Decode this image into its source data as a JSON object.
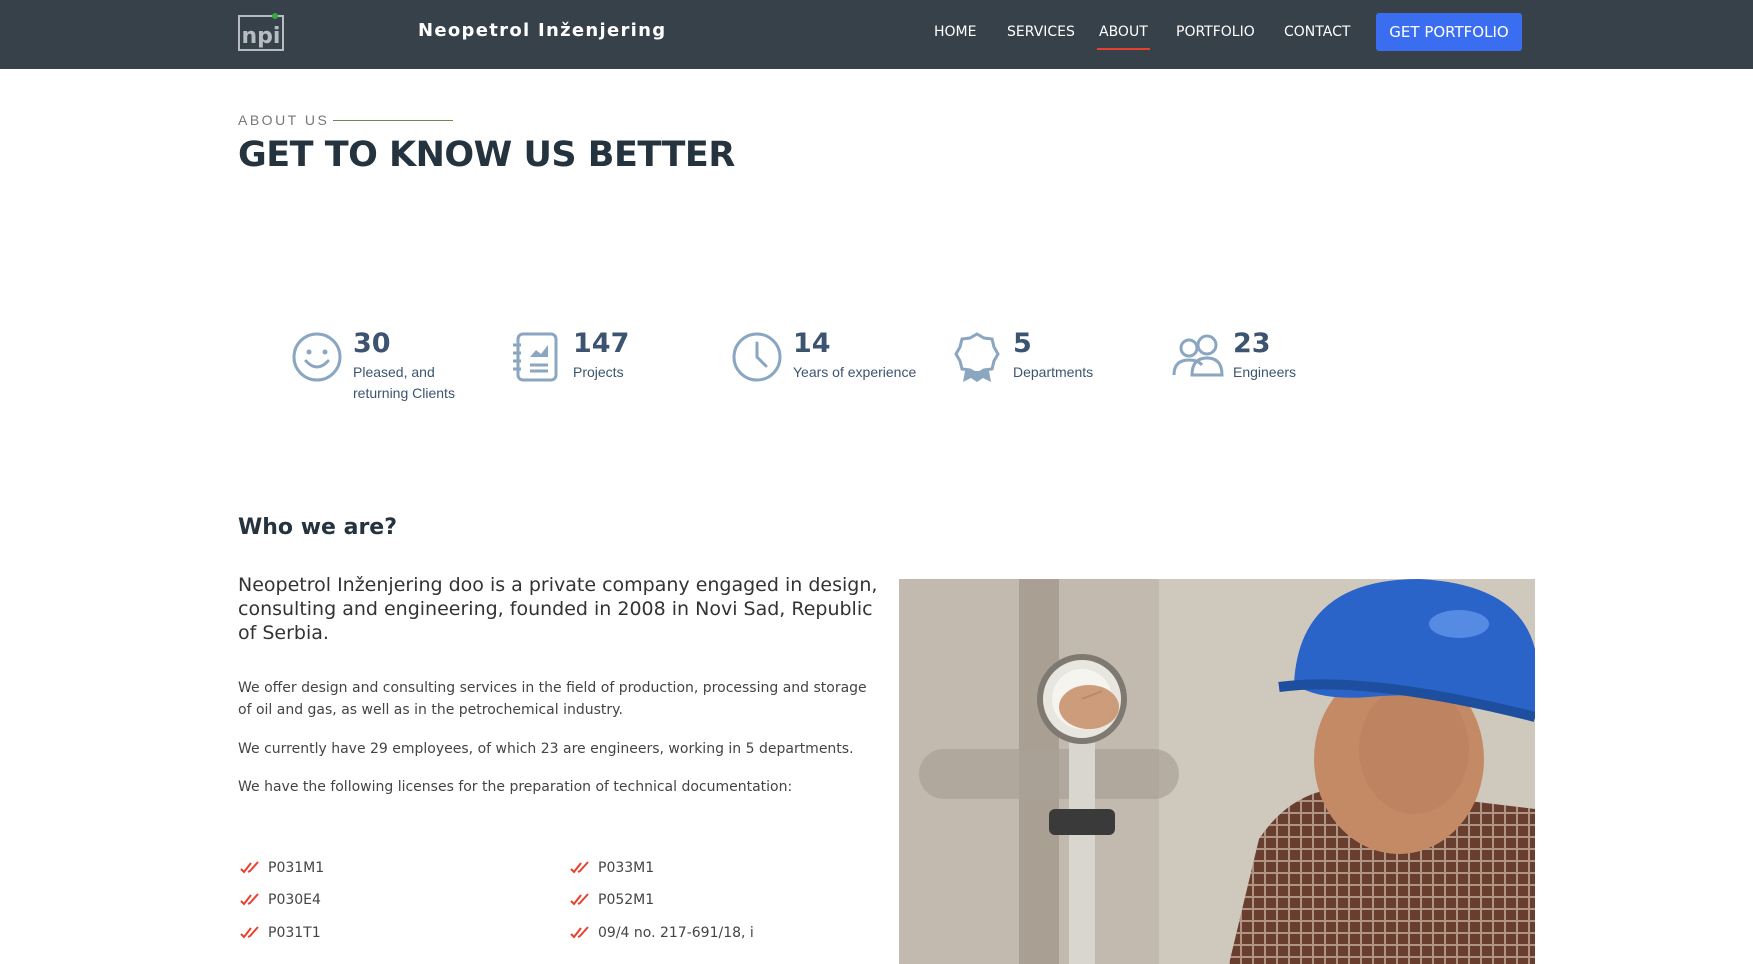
{
  "navbar": {
    "brand": "Neopetrol Inženjering",
    "logo_text": "npi",
    "links": [
      "HOME",
      "SERVICES",
      "ABOUT",
      "PORTFOLIO",
      "CONTACT"
    ],
    "active": "ABOUT",
    "cta": "GET PORTFOLIO",
    "colors": {
      "background": "#37414a",
      "accent": "#e8402f",
      "cta": "#3a6df0"
    }
  },
  "section": {
    "eyebrow": "ABOUT US",
    "title": "GET TO KNOW US BETTER"
  },
  "counters": [
    {
      "icon": "smile-icon",
      "value": "30",
      "label_lines": [
        "Pleased, and",
        "returning Clients"
      ]
    },
    {
      "icon": "report-icon",
      "value": "147",
      "label_lines": [
        "Projects"
      ]
    },
    {
      "icon": "clock-icon",
      "value": "14",
      "label_lines": [
        "Years of experience"
      ]
    },
    {
      "icon": "award-icon",
      "value": "5",
      "label_lines": [
        "Departments"
      ]
    },
    {
      "icon": "users-icon",
      "value": "23",
      "label_lines": [
        "Engineers"
      ]
    }
  ],
  "who": {
    "heading": "Who we are?",
    "lead_lines": [
      "Neopetrol Inženjering doo is a private company engaged in design,",
      "consulting and engineering, founded in 2008 in Novi Sad, Republic",
      "of Serbia."
    ],
    "para1_lines": [
      "We offer design and consulting services in the field of production, processing and storage",
      "of oil and gas, as well as in the petrochemical industry."
    ],
    "para2": "We currently have 29 employees, of which 23 are engineers, working in 5 departments.",
    "para3": "We have the following licenses for the preparation of technical documentation:",
    "licenses_left": [
      "P031M1",
      "P030E4",
      "P031T1"
    ],
    "licenses_right": [
      "P033M1",
      "P052M1",
      "09/4 no. 217-691/18, i"
    ]
  },
  "photo": {
    "icon": "engineer-photo",
    "colors": {
      "helmet": "#2a64c8",
      "shirt": "#6a3e2f"
    }
  }
}
